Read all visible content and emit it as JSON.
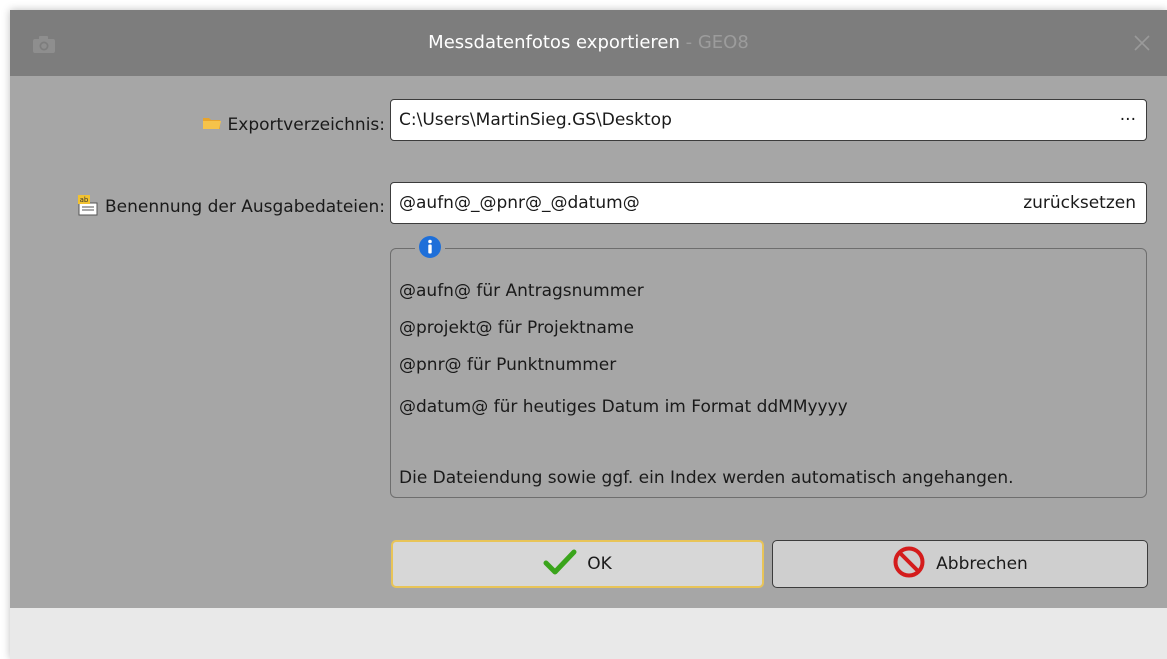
{
  "window": {
    "title": "Messdatenfotos exportieren",
    "title_suffix": " - GEO8"
  },
  "form": {
    "export_dir": {
      "label": "Exportverzeichnis:",
      "value": "C:\\Users\\MartinSieg.GS\\Desktop",
      "browse_label": "···"
    },
    "naming": {
      "label": "Benennung der Ausgabedateien:",
      "value": "@aufn@_@pnr@_@datum@",
      "reset_label": "zurücksetzen"
    }
  },
  "info": {
    "lines": [
      "@aufn@ für Antragsnummer",
      "@projekt@ für Projektname",
      "@pnr@ für Punktnummer",
      "@datum@ für heutiges Datum im Format ddMMyyyy",
      "Die Dateiendung sowie ggf. ein Index werden automatisch angehangen."
    ]
  },
  "buttons": {
    "ok": "OK",
    "cancel": "Abbrechen"
  },
  "colors": {
    "titlebar": "#7d7d7d",
    "dialog_bg": "#a6a6a6",
    "ok_border": "#e8c458",
    "ok_check": "#3aa41b",
    "cancel_icon": "#d41c1c",
    "info_icon": "#1e6fd9"
  },
  "icons": {
    "title": "camera-icon",
    "export_dir": "folder-icon",
    "naming": "rename-field-icon",
    "info": "info-icon",
    "ok": "checkmark-icon",
    "cancel": "prohibited-icon",
    "close": "close-icon"
  }
}
